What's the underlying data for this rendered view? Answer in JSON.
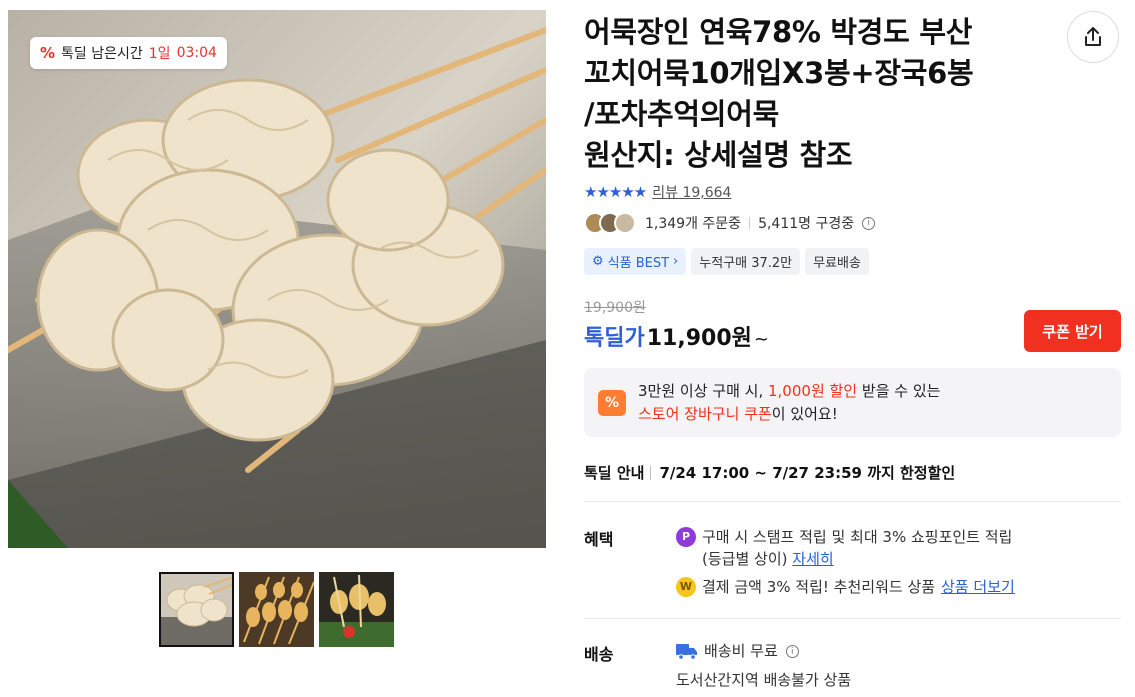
{
  "gallery": {
    "deal_badge": {
      "icon": "percent-icon",
      "label": "톡딜 남은시간",
      "days": "1일",
      "time": "03:04"
    },
    "thumbnails": [
      {
        "name": "thumb-1",
        "active": true
      },
      {
        "name": "thumb-2",
        "active": false
      },
      {
        "name": "thumb-3",
        "active": false
      }
    ]
  },
  "product": {
    "title_line1": "어묵장인 연육78% 박경도 부산",
    "title_line2": "꼬치어묵10개입X3봉+장국6봉",
    "title_line3": "/포차추억의어묵",
    "title_line4": "원산지: 상세설명 참조",
    "share_icon": "share-icon",
    "rating_stars": "★★★★★",
    "review_label": "리뷰 19,664",
    "orders": "1,349개 주문중",
    "viewers": "5,411명 구경중"
  },
  "tags": [
    {
      "label": "식품 BEST",
      "style": "blue"
    },
    {
      "label": "누적구매 37.2만",
      "style": "gray"
    },
    {
      "label": "무료배송",
      "style": "gray"
    }
  ],
  "price": {
    "original": "19,900원",
    "label": "톡딜가",
    "value": "11,900원",
    "suffix": "~",
    "coupon_button": "쿠폰 받기"
  },
  "coupon_notice": {
    "icon_text": "%",
    "line1_a": "3만원 이상 구매 시,",
    "line1_b": "1,000원 할인",
    "line1_c": "받을 수 있는",
    "line2_a": "스토어 장바구니 쿠폰",
    "line2_b": "이 있어요!"
  },
  "deal_info": {
    "label": "톡딜 안내",
    "value": "7/24 17:00 ~ 7/27 23:59 까지 한정할인"
  },
  "benefits": {
    "label": "혜택",
    "item1_text": "구매 시 스탬프 적립 및 최대 3% 쇼핑포인트 적립",
    "item1_text2": "(등급별 상이)",
    "item1_link": "자세히",
    "item1_icon": "P",
    "item2_text": "결제 금액 3% 적립! 추천리워드 상품",
    "item2_link": "상품 더보기",
    "item2_icon": "W"
  },
  "shipping": {
    "label": "배송",
    "fee": "배송비 무료",
    "note": "도서산간지역 배송불가 상품"
  },
  "colors": {
    "accent_blue": "#2f5fd8",
    "accent_red": "#f2301f",
    "coupon_orange": "#ff7d31"
  }
}
